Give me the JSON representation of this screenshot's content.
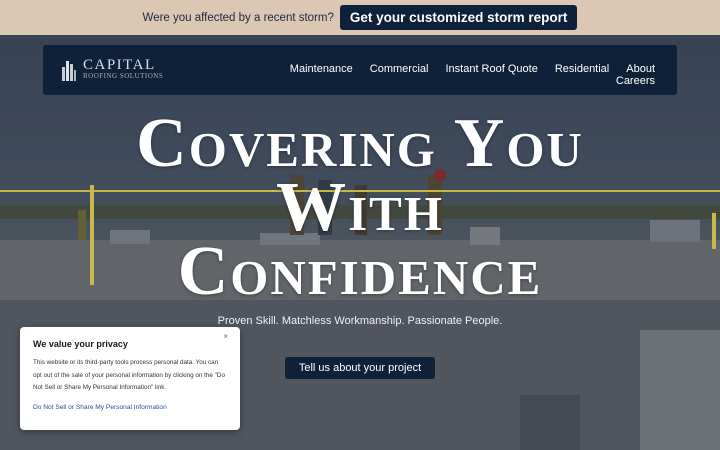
{
  "top_bar": {
    "question": "Were you affected by a recent storm?",
    "cta_label": "Get your customized storm report"
  },
  "nav": {
    "logo_line1": "CAPITAL",
    "logo_line2": "ROOFING SOLUTIONS",
    "items": [
      {
        "label": "Maintenance"
      },
      {
        "label": "Commercial"
      },
      {
        "label": "Instant Roof Quote"
      },
      {
        "label": "Residential"
      },
      {
        "label": "About"
      }
    ],
    "careers_label": "Careers"
  },
  "hero": {
    "headline_line1": "Covering You",
    "headline_line2": "With",
    "headline_line3": "Confidence",
    "tagline": "Proven Skill. Matchless Workmanship. Passionate People.",
    "cta_label": "Tell us about your project"
  },
  "privacy": {
    "title": "We value your privacy",
    "body": "This website or its third-party tools process personal data. You can opt out of the sale of your personal information by clicking on the \"Do Not Sell or Share My Personal Information\" link.",
    "link": "Do Not Sell or Share My Personal Information",
    "close": "×"
  },
  "colors": {
    "top_bar_bg": "#dcc6b4",
    "navy": "#0f2138",
    "link_blue": "#1f4f9a"
  }
}
